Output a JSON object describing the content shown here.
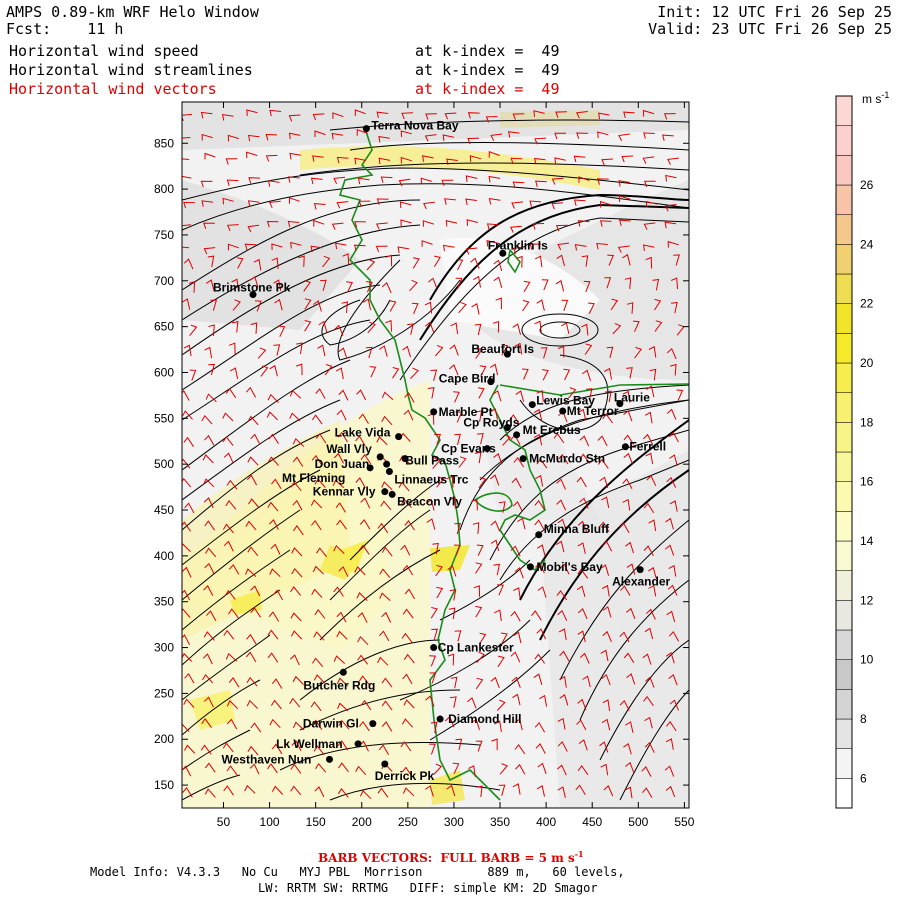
{
  "header": {
    "title": "AMPS 0.89-km WRF Helo Window",
    "fcst_label": "Fcst:",
    "fcst_value": "11 h",
    "init": "Init: 12 UTC Fri 26 Sep 25",
    "valid": "Valid: 23 UTC Fri 26 Sep 25",
    "fields": [
      {
        "name": "Horizontal wind speed",
        "level": "at k-index =  49",
        "color": "#000000"
      },
      {
        "name": "Horizontal wind streamlines",
        "level": "at k-index =  49",
        "color": "#000000"
      },
      {
        "name": "Horizontal wind vectors",
        "level": "at k-index =  49",
        "color": "#e00000"
      }
    ]
  },
  "map": {
    "x_ticks": [
      "50",
      "100",
      "150",
      "200",
      "250",
      "300",
      "350",
      "400",
      "450",
      "500",
      "550"
    ],
    "y_ticks": [
      "150",
      "200",
      "250",
      "300",
      "350",
      "400",
      "450",
      "500",
      "550",
      "600",
      "650",
      "700",
      "750",
      "800",
      "850"
    ],
    "x_range": [
      5,
      555
    ],
    "y_range": [
      125,
      895
    ],
    "stations": [
      {
        "name": "Terra Nova Bay",
        "x": 205,
        "y": 866,
        "lx": 5,
        "ly": -3
      },
      {
        "name": "Franklin Is",
        "x": 353,
        "y": 730,
        "lx": -15,
        "ly": -8
      },
      {
        "name": "Brimstone Pk",
        "x": 82,
        "y": 685,
        "lx": -40,
        "ly": -7
      },
      {
        "name": "Beaufort Is",
        "x": 358,
        "y": 620,
        "lx": -36,
        "ly": -5
      },
      {
        "name": "Cape Bird",
        "x": 340,
        "y": 590,
        "lx": -52,
        "ly": -3
      },
      {
        "name": "Lewis Bay",
        "x": 385,
        "y": 565,
        "lx": 4,
        "ly": -4
      },
      {
        "name": "Laurie",
        "x": 480,
        "y": 566,
        "lx": -6,
        "ly": -6
      },
      {
        "name": "Mt Terror",
        "x": 418,
        "y": 558,
        "lx": 4,
        "ly": 0
      },
      {
        "name": "Marble Pt",
        "x": 278,
        "y": 557,
        "lx": 5,
        "ly": 0
      },
      {
        "name": "Cp Royds",
        "x": 358,
        "y": 540,
        "lx": -44,
        "ly": -5
      },
      {
        "name": "Mt Erebus",
        "x": 368,
        "y": 532,
        "lx": 6,
        "ly": -5
      },
      {
        "name": "Lake Vida",
        "x": 240,
        "y": 530,
        "lx": -64,
        "ly": -4
      },
      {
        "name": "Cp Evans",
        "x": 336,
        "y": 517,
        "lx": -46,
        "ly": 0
      },
      {
        "name": "Ferrell",
        "x": 486,
        "y": 519,
        "lx": 4,
        "ly": 0
      },
      {
        "name": "Wall Vly",
        "x": 220,
        "y": 508,
        "lx": -54,
        "ly": -8
      },
      {
        "name": "McMurdo Stn",
        "x": 375,
        "y": 506,
        "lx": 6,
        "ly": 0
      },
      {
        "name": "Bull Pass",
        "x": 247,
        "y": 506,
        "lx": 0,
        "ly": 2
      },
      {
        "name": "Don Juan",
        "x": 227,
        "y": 500,
        "lx": -72,
        "ly": 0
      },
      {
        "name": "Linnaeus Trc",
        "x": 230,
        "y": 492,
        "lx": 5,
        "ly": 8
      },
      {
        "name": "Mt Fleming",
        "x": 209,
        "y": 496,
        "lx": -88,
        "ly": 10
      },
      {
        "name": "Kennar Vly",
        "x": 225,
        "y": 470,
        "lx": -72,
        "ly": 0
      },
      {
        "name": "Beacon Vly",
        "x": 233,
        "y": 467,
        "lx": 5,
        "ly": 7
      },
      {
        "name": "Minna Bluff",
        "x": 392,
        "y": 423,
        "lx": 5,
        "ly": -6
      },
      {
        "name": "Mobil's Bay",
        "x": 383,
        "y": 388,
        "lx": 6,
        "ly": 0
      },
      {
        "name": "Alexander",
        "x": 502,
        "y": 385,
        "lx": -28,
        "ly": 12
      },
      {
        "name": "Cp Lankester",
        "x": 278,
        "y": 300,
        "lx": 4,
        "ly": 0
      },
      {
        "name": "Butcher Rdg",
        "x": 180,
        "y": 273,
        "lx": -40,
        "ly": 13
      },
      {
        "name": "Darwin Gl",
        "x": 212,
        "y": 217,
        "lx": -70,
        "ly": 0
      },
      {
        "name": "Diamond Hill",
        "x": 285,
        "y": 222,
        "lx": 8,
        "ly": 0
      },
      {
        "name": "Lk Wellman",
        "x": 196,
        "y": 195,
        "lx": -82,
        "ly": 0
      },
      {
        "name": "Westhaven Nun",
        "x": 165,
        "y": 178,
        "lx": -108,
        "ly": 0
      },
      {
        "name": "Derrick Pk",
        "x": 225,
        "y": 173,
        "lx": -10,
        "ly": 12
      }
    ]
  },
  "colorbar": {
    "unit": "m s",
    "unit_sup": "-1",
    "ticks": [
      "6",
      "8",
      "10",
      "12",
      "14",
      "16",
      "18",
      "20",
      "22",
      "24",
      "26"
    ],
    "bins": [
      {
        "lo": 5,
        "color": "#ffffff"
      },
      {
        "lo": 6,
        "color": "#f4f4f4"
      },
      {
        "lo": 7,
        "color": "#e4e4e4"
      },
      {
        "lo": 8,
        "color": "#d4d4d4"
      },
      {
        "lo": 9,
        "color": "#c8c8c8"
      },
      {
        "lo": 10,
        "color": "#d8d8d8"
      },
      {
        "lo": 11,
        "color": "#e8e8e0"
      },
      {
        "lo": 12,
        "color": "#f0f0dc"
      },
      {
        "lo": 13,
        "color": "#fafad2"
      },
      {
        "lo": 14,
        "color": "#fcfcc6"
      },
      {
        "lo": 15,
        "color": "#fbfab0"
      },
      {
        "lo": 16,
        "color": "#faf69c"
      },
      {
        "lo": 17,
        "color": "#f8f488"
      },
      {
        "lo": 18,
        "color": "#f8f070"
      },
      {
        "lo": 19,
        "color": "#f6ee4c"
      },
      {
        "lo": 20,
        "color": "#f4ea2a"
      },
      {
        "lo": 21,
        "color": "#f2e428"
      },
      {
        "lo": 22,
        "color": "#f0dc50"
      },
      {
        "lo": 23,
        "color": "#f0d070"
      },
      {
        "lo": 24,
        "color": "#f4c88c"
      },
      {
        "lo": 25,
        "color": "#f8c4a8"
      },
      {
        "lo": 26,
        "color": "#fac8c0"
      },
      {
        "lo": 27,
        "color": "#fcd0cc"
      },
      {
        "lo": 28,
        "color": "#fcd8d4"
      }
    ]
  },
  "footer": {
    "barb_note": "BARB VECTORS:  FULL BARB = 5 m s",
    "barb_sup": "-1",
    "model_info": "Model Info: V4.3.3   No Cu   MYJ PBL  Morrison         889 m,   60 levels,",
    "model_info2": "LW: RRTM SW: RRTMG   DIFF: simple KM: 2D Smagor"
  },
  "colors": {
    "vector": "#e00000",
    "coast": "#1a8c1a",
    "contour": "#000000"
  }
}
